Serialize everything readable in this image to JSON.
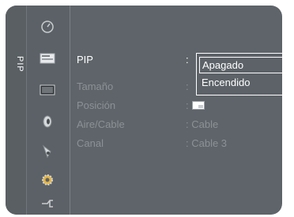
{
  "menu": {
    "section_label": "PIP",
    "icons": [
      "clock-icon",
      "input-icon",
      "picture-icon",
      "sound-icon",
      "channel-icon",
      "setup-icon",
      "plug-icon"
    ],
    "rows": [
      {
        "name": "PIP",
        "value": ":",
        "state": "active"
      },
      {
        "name": "Tamaño",
        "value": ":",
        "state": "disabled"
      },
      {
        "name": "Posición",
        "value": ":",
        "state": "disabled"
      },
      {
        "name": "Aire/Cable",
        "value": ": Cable",
        "state": "disabled"
      },
      {
        "name": "Canal",
        "value": ": Cable 3",
        "state": "disabled"
      }
    ]
  },
  "dropdown": {
    "options": [
      "Apagado",
      "Encendido"
    ],
    "selected": "Apagado"
  },
  "colors": {
    "panel_bg": "#5e6469",
    "active_text": "#ffffff",
    "disabled_text": "#8c9196",
    "highlight_border": "#ffffff"
  }
}
